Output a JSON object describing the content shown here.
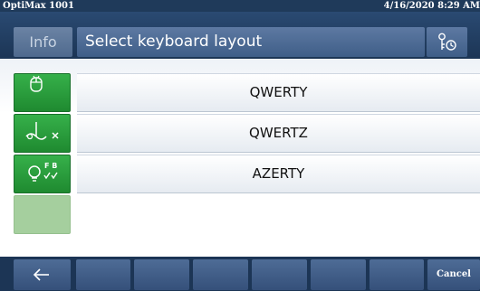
{
  "status": {
    "device_name": "OptiMax 1001",
    "datetime": "4/16/2020 8:29 AM"
  },
  "header": {
    "info_label": "Info",
    "title": "Select keyboard layout",
    "tools_icon": "key-clock-icon"
  },
  "side_buttons": [
    {
      "icon": "mouse-icon"
    },
    {
      "icon": "stirrer-cancel-icon"
    },
    {
      "icon": "lightbulb-fb-check-icon",
      "badge": "F B"
    },
    {
      "icon": "blank",
      "state": "disabled"
    }
  ],
  "layouts": [
    "QWERTY",
    "QWERTZ",
    "AZERTY"
  ],
  "bottom": {
    "back_icon": "arrow-left-icon",
    "cancel_label": "Cancel"
  },
  "colors": {
    "status_bar": "#1f3a5a",
    "header": "#2a4a72",
    "button_blue": "#4e6c96",
    "button_green": "#2a9c3e"
  }
}
